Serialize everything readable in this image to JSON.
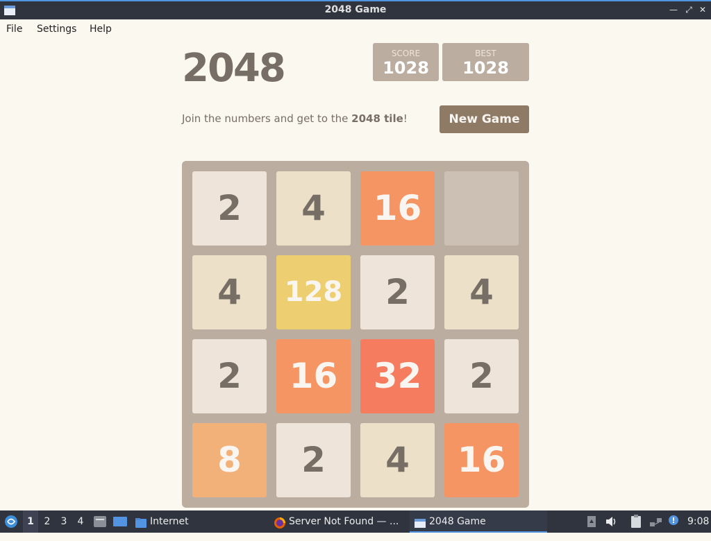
{
  "window": {
    "title": "2048 Game",
    "controls": [
      "minimize",
      "maximize",
      "close"
    ]
  },
  "menu": {
    "items": [
      "File",
      "Settings",
      "Help"
    ]
  },
  "game": {
    "title": "2048",
    "score_label": "SCORE",
    "score": "1028",
    "best_label": "BEST",
    "best": "1028",
    "intro_prefix": "Join the numbers and get to the ",
    "intro_bold": "2048 tile",
    "intro_suffix": "!",
    "new_game_label": "New Game",
    "board": [
      [
        "2",
        "4",
        "16",
        ""
      ],
      [
        "4",
        "128",
        "2",
        "4"
      ],
      [
        "2",
        "16",
        "32",
        "2"
      ],
      [
        "8",
        "2",
        "4",
        "16"
      ]
    ]
  },
  "colors": {
    "tile_2": "#eee4da",
    "tile_4": "#ede0c8",
    "tile_8": "#f2b179",
    "tile_16": "#f59563",
    "tile_32": "#f67c5f",
    "tile_128": "#edcf72",
    "board": "#bbada0",
    "button": "#8f7a66"
  },
  "taskbar": {
    "workspaces": [
      "1",
      "2",
      "3",
      "4"
    ],
    "active_workspace": "1",
    "tasks": [
      {
        "label": "Internet",
        "icon": "folder-icon"
      },
      {
        "label": "Server Not Found — ...",
        "icon": "firefox-icon"
      },
      {
        "label": "2048 Game",
        "icon": "window-icon"
      }
    ],
    "clock": "9:08"
  }
}
